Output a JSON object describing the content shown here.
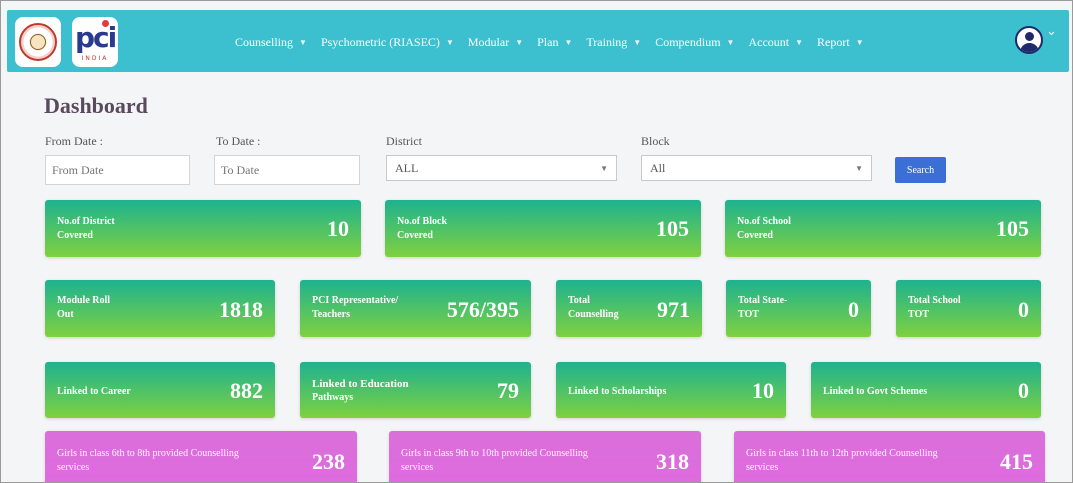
{
  "header": {
    "logo_left": "State education seal",
    "logo_right": {
      "mark": "pci",
      "sub": "INDIA"
    },
    "nav": [
      "Counselling",
      "Psychometric (RIASEC)",
      "Modular",
      "Plan",
      "Training",
      "Compendium",
      "Account",
      "Report"
    ],
    "avatar_icon": "user-circle-icon"
  },
  "page": {
    "title": "Dashboard"
  },
  "filters": {
    "from_label": "From Date :",
    "from_placeholder": "From Date",
    "to_label": "To Date :",
    "to_placeholder": "To Date",
    "district_label": "District",
    "district_value": "ALL",
    "block_label": "Block",
    "block_value": "All",
    "search_label": "Search"
  },
  "cards": {
    "district": {
      "label1": "No.of District",
      "label2": "Covered",
      "value": "10"
    },
    "block": {
      "label1": "No.of Block",
      "label2": "Covered",
      "value": "105"
    },
    "school": {
      "label1": "No.of School",
      "label2": "Covered",
      "value": "105"
    },
    "module": {
      "label1": "Module Roll",
      "label2": "Out",
      "value": "1818"
    },
    "pci": {
      "label1": "PCI Representative/",
      "label2": "Teachers",
      "value": "576/395"
    },
    "counselling": {
      "label1": "Total",
      "label2": "Counselling",
      "value": "971"
    },
    "state_tot": {
      "label1": "Total State-",
      "label2": "TOT",
      "value": "0"
    },
    "school_tot": {
      "label1": "Total School",
      "label2": "TOT",
      "value": "0"
    },
    "career": {
      "label1": "Linked to Career",
      "value": "882"
    },
    "education": {
      "label1": "Linked to Education",
      "label2": "Pathways",
      "value": "79"
    },
    "scholarships": {
      "label1": "Linked to Scholarships",
      "value": "10"
    },
    "govt": {
      "label1": "Linked to Govt Schemes",
      "value": "0"
    },
    "girls_6_8": {
      "label1": "Girls in class 6th to 8th provided Counselling",
      "label2": "services",
      "value": "238"
    },
    "girls_9_10": {
      "label1": "Girls in class 9th to 10th provided Counselling",
      "label2": "services",
      "value": "318"
    },
    "girls_11_12": {
      "label1": "Girls in class 11th to 12th provided Counselling",
      "label2": "services",
      "value": "415"
    }
  },
  "colors": {
    "header": "#3cbfcf",
    "card_green_top": "#1db290",
    "card_green_bottom": "#7fd13f",
    "card_pink": "#dd6bdd",
    "search_button": "#3b6fd6"
  }
}
